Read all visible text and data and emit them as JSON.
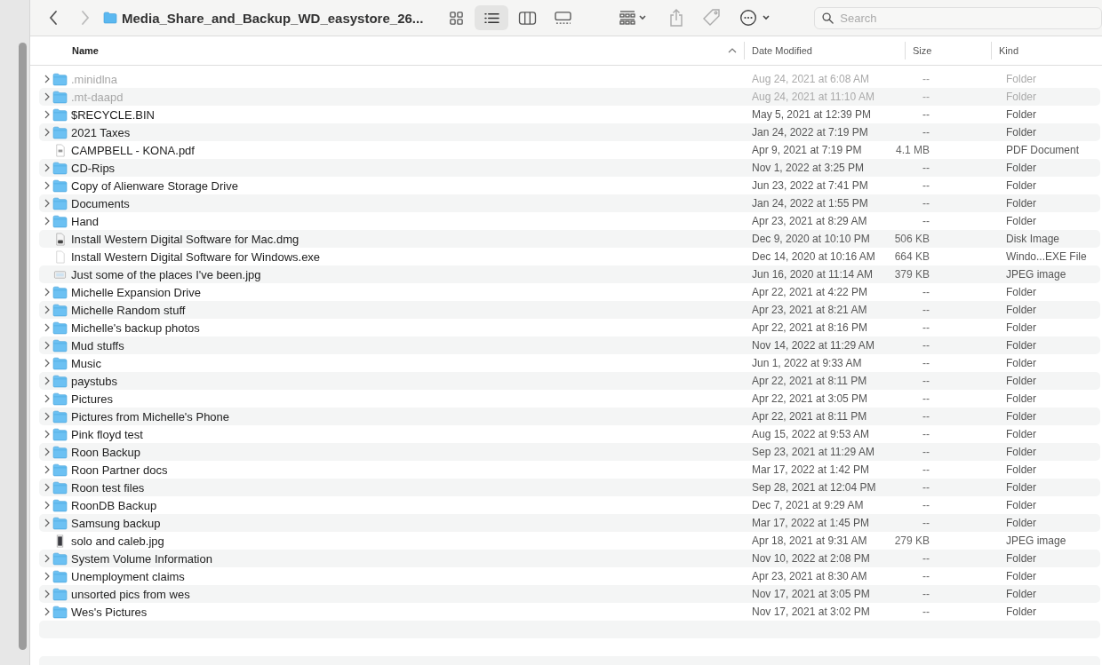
{
  "toolbar": {
    "title": "Media_Share_and_Backup_WD_easystore_26...",
    "view_modes": [
      {
        "kind": "icons",
        "selected": false
      },
      {
        "kind": "list",
        "selected": true
      },
      {
        "kind": "columns",
        "selected": false
      },
      {
        "kind": "gallery",
        "selected": false
      }
    ],
    "search": {
      "placeholder": "Search"
    }
  },
  "columns": [
    {
      "label": "Name",
      "sorted": true
    },
    {
      "label": "Date Modified",
      "sorted": false
    },
    {
      "label": "Size",
      "sorted": false
    },
    {
      "label": "Kind",
      "sorted": false
    }
  ],
  "rows": [
    {
      "name": ".minidlna",
      "kind": "folder",
      "dimmed": true,
      "date": "Aug 24, 2021 at 6:08 AM",
      "size": "--",
      "type": "Folder"
    },
    {
      "name": ".mt-daapd",
      "kind": "folder",
      "dimmed": true,
      "date": "Aug 24, 2021 at 11:10 AM",
      "size": "--",
      "type": "Folder"
    },
    {
      "name": "$RECYCLE.BIN",
      "kind": "folder",
      "dimmed": false,
      "date": "May 5, 2021 at 12:39 PM",
      "size": "--",
      "type": "Folder"
    },
    {
      "name": "2021 Taxes",
      "kind": "folder",
      "dimmed": false,
      "date": "Jan 24, 2022 at 7:19 PM",
      "size": "--",
      "type": "Folder"
    },
    {
      "name": "CAMPBELL - KONA.pdf",
      "kind": "pdf",
      "dimmed": false,
      "date": "Apr 9, 2021 at 7:19 PM",
      "size": "4.1 MB",
      "type": "PDF Document"
    },
    {
      "name": "CD-Rips",
      "kind": "folder",
      "dimmed": false,
      "date": "Nov 1, 2022 at 3:25 PM",
      "size": "--",
      "type": "Folder"
    },
    {
      "name": "Copy of Alienware Storage Drive",
      "kind": "folder",
      "dimmed": false,
      "date": "Jun 23, 2022 at 7:41 PM",
      "size": "--",
      "type": "Folder"
    },
    {
      "name": "Documents",
      "kind": "folder",
      "dimmed": false,
      "date": "Jan 24, 2022 at 1:55 PM",
      "size": "--",
      "type": "Folder"
    },
    {
      "name": "Hand",
      "kind": "folder",
      "dimmed": false,
      "date": "Apr 23, 2021 at 8:29 AM",
      "size": "--",
      "type": "Folder"
    },
    {
      "name": "Install Western Digital Software for Mac.dmg",
      "kind": "disk",
      "dimmed": false,
      "date": "Dec 9, 2020 at 10:10 PM",
      "size": "506 KB",
      "type": "Disk Image"
    },
    {
      "name": "Install Western Digital Software for Windows.exe",
      "kind": "file",
      "dimmed": false,
      "date": "Dec 14, 2020 at 10:16 AM",
      "size": "664 KB",
      "type": "Windo...EXE File"
    },
    {
      "name": "Just some of the places I've been.jpg",
      "kind": "image",
      "dimmed": false,
      "date": "Jun 16, 2020 at 11:14 AM",
      "size": "379 KB",
      "type": "JPEG image"
    },
    {
      "name": "Michelle Expansion Drive",
      "kind": "folder",
      "dimmed": false,
      "date": "Apr 22, 2021 at 4:22 PM",
      "size": "--",
      "type": "Folder"
    },
    {
      "name": "Michelle Random stuff",
      "kind": "folder",
      "dimmed": false,
      "date": "Apr 23, 2021 at 8:21 AM",
      "size": "--",
      "type": "Folder"
    },
    {
      "name": "Michelle's backup photos",
      "kind": "folder",
      "dimmed": false,
      "date": "Apr 22, 2021 at 8:16 PM",
      "size": "--",
      "type": "Folder"
    },
    {
      "name": "Mud stuffs",
      "kind": "folder",
      "dimmed": false,
      "date": "Nov 14, 2022 at 11:29 AM",
      "size": "--",
      "type": "Folder"
    },
    {
      "name": "Music",
      "kind": "folder",
      "dimmed": false,
      "date": "Jun 1, 2022 at 9:33 AM",
      "size": "--",
      "type": "Folder"
    },
    {
      "name": "paystubs",
      "kind": "folder",
      "dimmed": false,
      "date": "Apr 22, 2021 at 8:11 PM",
      "size": "--",
      "type": "Folder"
    },
    {
      "name": "Pictures",
      "kind": "folder",
      "dimmed": false,
      "date": "Apr 22, 2021 at 3:05 PM",
      "size": "--",
      "type": "Folder"
    },
    {
      "name": "Pictures from Michelle's Phone",
      "kind": "folder",
      "dimmed": false,
      "date": "Apr 22, 2021 at 8:11 PM",
      "size": "--",
      "type": "Folder"
    },
    {
      "name": "Pink floyd test",
      "kind": "folder",
      "dimmed": false,
      "date": "Aug 15, 2022 at 9:53 AM",
      "size": "--",
      "type": "Folder"
    },
    {
      "name": "Roon Backup",
      "kind": "folder",
      "dimmed": false,
      "date": "Sep 23, 2021 at 11:29 AM",
      "size": "--",
      "type": "Folder"
    },
    {
      "name": "Roon Partner docs",
      "kind": "folder",
      "dimmed": false,
      "date": "Mar 17, 2022 at 1:42 PM",
      "size": "--",
      "type": "Folder"
    },
    {
      "name": "Roon test files",
      "kind": "folder",
      "dimmed": false,
      "date": "Sep 28, 2021 at 12:04 PM",
      "size": "--",
      "type": "Folder"
    },
    {
      "name": "RoonDB Backup",
      "kind": "folder",
      "dimmed": false,
      "date": "Dec 7, 2021 at 9:29 AM",
      "size": "--",
      "type": "Folder"
    },
    {
      "name": "Samsung backup",
      "kind": "folder",
      "dimmed": false,
      "date": "Mar 17, 2022 at 1:45 PM",
      "size": "--",
      "type": "Folder"
    },
    {
      "name": "solo and caleb.jpg",
      "kind": "photo",
      "dimmed": false,
      "date": "Apr 18, 2021 at 9:31 AM",
      "size": "279 KB",
      "type": "JPEG image"
    },
    {
      "name": "System Volume Information",
      "kind": "folder",
      "dimmed": false,
      "date": "Nov 10, 2022 at 2:08 PM",
      "size": "--",
      "type": "Folder"
    },
    {
      "name": "Unemployment claims",
      "kind": "folder",
      "dimmed": false,
      "date": "Apr 23, 2021 at 8:30 AM",
      "size": "--",
      "type": "Folder"
    },
    {
      "name": "unsorted pics from wes",
      "kind": "folder",
      "dimmed": false,
      "date": "Nov 17, 2021 at 3:05 PM",
      "size": "--",
      "type": "Folder"
    },
    {
      "name": "Wes's Pictures",
      "kind": "folder",
      "dimmed": false,
      "date": "Nov 17, 2021 at 3:02 PM",
      "size": "--",
      "type": "Folder"
    }
  ]
}
